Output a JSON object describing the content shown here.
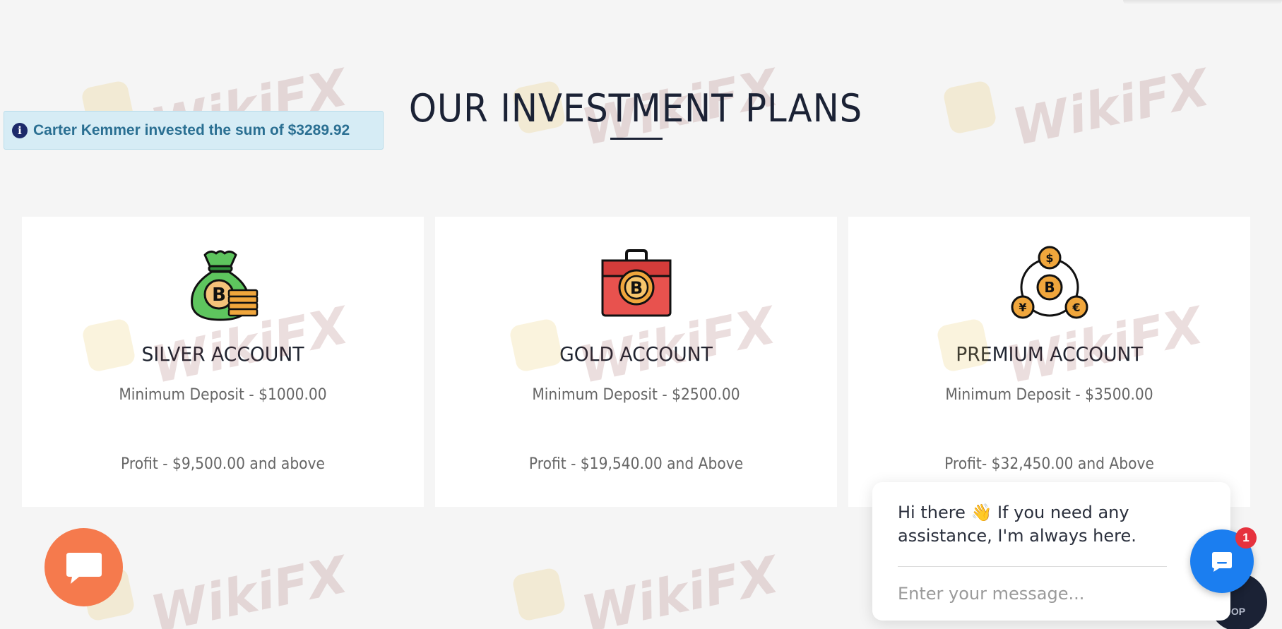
{
  "section": {
    "title": "OUR INVESTMENT PLANS"
  },
  "notification": {
    "icon": "info-icon",
    "text": "Carter Kemmer invested the sum of $3289.92"
  },
  "plans": [
    {
      "icon": "money-bag-bitcoin-icon",
      "name": "SILVER ACCOUNT",
      "deposit": "Minimum Deposit - $1000.00",
      "profit": "Profit - $9,500.00 and above"
    },
    {
      "icon": "briefcase-bitcoin-icon",
      "name": "GOLD ACCOUNT",
      "deposit": "Minimum Deposit - $2500.00",
      "profit": "Profit - $19,540.00 and Above"
    },
    {
      "icon": "coins-exchange-icon",
      "name": "PREMIUM ACCOUNT",
      "deposit": "Minimum Deposit - $3500.00",
      "profit": "Profit- $32,450.00 and Above"
    }
  ],
  "watermark": {
    "text": "WikiFX"
  },
  "chat_widget": {
    "message": "Hi there 👋 If you need any assistance, I'm always here.",
    "input_placeholder": "Enter your message...",
    "badge_count": "1",
    "accent_color": "#1b7ef0"
  },
  "left_chat": {
    "icon": "chat-bubble-icon",
    "color": "#f57a4d"
  },
  "top_button": {
    "label": "OP"
  }
}
